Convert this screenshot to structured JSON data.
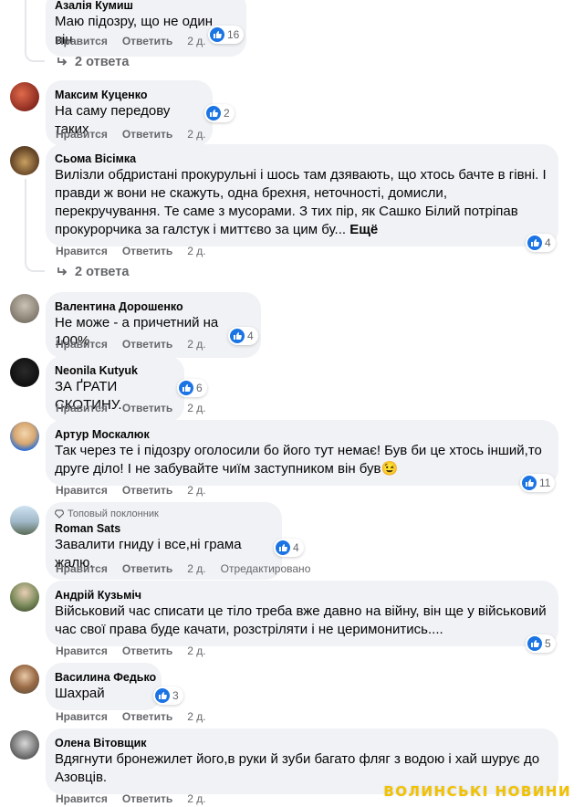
{
  "actions": {
    "like": "Нравится",
    "reply": "Ответить",
    "edited": "Отредактировано"
  },
  "brand": {
    "like_color": "#1b74e4",
    "watermark_color": "#f2c200"
  },
  "comments": [
    {
      "author": "Азалія Кумиш",
      "text": "Маю підозру, що не один він.",
      "time": "2 д.",
      "reactions": "16",
      "replies": "2 ответа"
    },
    {
      "author": "Максим Куценко",
      "text": "На саму передову таких",
      "time": "2 д.",
      "reactions": "2"
    },
    {
      "author": "Сьома Вісімка",
      "text": "Вилізли обдристані прокурульні і шось там дзявають, що хтось бачте в гівні. І правди ж вони не скажуть, одна брехня, неточності, домисли, перекручування. Те саме з мусорами. З тих пір, як Сашко Білий потріпав прокурорчика за галстук і миттєво за цим бу...",
      "more": "Ещё",
      "time": "2 д.",
      "reactions": "4",
      "replies": "2 ответа"
    },
    {
      "author": "Валентина Дорошенко",
      "text": "Не може - а причетний на 100%",
      "time": "2 д.",
      "reactions": "4"
    },
    {
      "author": "Neonila Kutyuk",
      "text": "ЗА ҐРАТИ СКОТИНУ.",
      "time": "2 д.",
      "reactions": "6"
    },
    {
      "author": "Артур Москалюк",
      "text": "Так через те і підозру оголосили бо його тут немає! Був би це хтось інший,то друге діло! І не забувайте чиїм заступником він був😉",
      "time": "2 д.",
      "reactions": "11"
    },
    {
      "badge": "Топовый поклонник",
      "author": "Roman Sats",
      "text": "Завалити гниду і все,ні грама жалю.",
      "time": "2 д.",
      "reactions": "4",
      "edited": true
    },
    {
      "author": "Андрій Кузьміч",
      "text": "Військовий час списати це тіло треба вже давно на війну, він ще у військовий час свої права буде качати, розстріляти і не церимонитись....",
      "time": "2 д.",
      "reactions": "5"
    },
    {
      "author": "Василина Федько",
      "text": "Шахрай",
      "time": "2 д.",
      "reactions": "3"
    },
    {
      "author": "Олена Вітовщик",
      "text": "Вдягнути бронежилет його,в руки й зуби багато фляг з водою і хай шурує до Азовців.",
      "time": "2 д."
    }
  ],
  "watermark": "ВОЛИНСЬКІ НОВИНИ"
}
